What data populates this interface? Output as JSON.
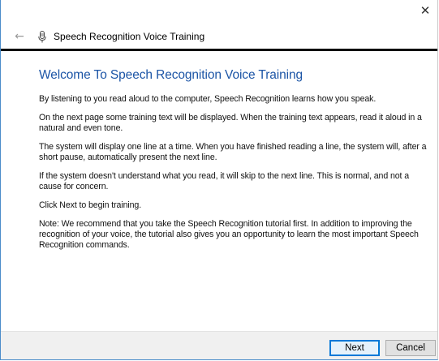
{
  "window": {
    "close_icon": "close-icon"
  },
  "header": {
    "back_icon": "back-arrow-icon",
    "app_icon": "microphone-icon",
    "title": "Speech Recognition Voice Training"
  },
  "main": {
    "title": "Welcome To Speech Recognition Voice Training",
    "paragraphs": [
      "By listening to you read aloud to the computer, Speech Recognition learns how you speak.",
      "On the next page some training text will be displayed. When the training text appears, read it aloud in a natural and even tone.",
      "The system will display one line at a time. When you have finished reading a line, the system will, after a short pause, automatically present the next line.",
      "If the system doesn't understand what you read, it will skip to the next line. This is normal, and not a cause for concern.",
      "Click Next to begin training.",
      "Note: We recommend that you take the Speech Recognition tutorial first. In addition to improving the recognition of your voice, the tutorial also gives you an opportunity to learn the most important Speech Recognition commands."
    ]
  },
  "footer": {
    "next_label": "Next",
    "cancel_label": "Cancel"
  },
  "colors": {
    "title": "#1c55a6",
    "window_border": "#4c8dca",
    "footer_bg": "#f0f0f0",
    "default_button_border": "#0078d7"
  }
}
